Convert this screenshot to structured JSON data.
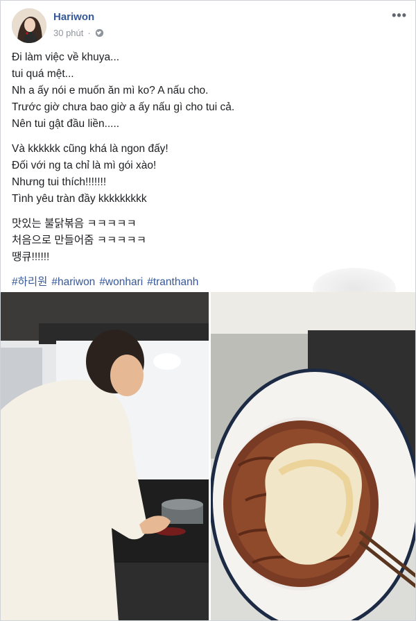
{
  "post": {
    "author": "Hariwon",
    "time": "30 phút",
    "privacy_icon": "globe-icon",
    "more_icon": "more-horizontal-icon"
  },
  "content": {
    "paragraph1": [
      "Đi làm việc về khuya...",
      "tui quá mệt...",
      "Nh a ấy nói e muốn ăn mì ko? A nấu cho.",
      "Trước giờ chưa bao giờ a ấy nấu gì cho tui cả.",
      "Nên tui gật đầu liền....."
    ],
    "paragraph2": [
      "Và kkkkkk cũng khá là ngon đấy!",
      "Đối với ng ta chỉ là mì gói xào!",
      "Nhưng tui thích!!!!!!!",
      "Tình yêu tràn đầy kkkkkkkkk"
    ],
    "paragraph3": [
      "맛있는 불닭볶음 ㅋㅋㅋㅋㅋ",
      "처음으로 만들어줌 ㅋㅋㅋㅋㅋ",
      "땡큐!!!!!!"
    ],
    "hashtags": [
      "#하리원",
      "#hariwon",
      "#wonhari",
      "#tranthanh"
    ]
  },
  "photos": [
    {
      "description_icon": "photo-man-cooking"
    },
    {
      "description_icon": "photo-noodles-egg"
    }
  ],
  "colors": {
    "link": "#365899",
    "meta": "#90949c",
    "text": "#1c1e21"
  }
}
